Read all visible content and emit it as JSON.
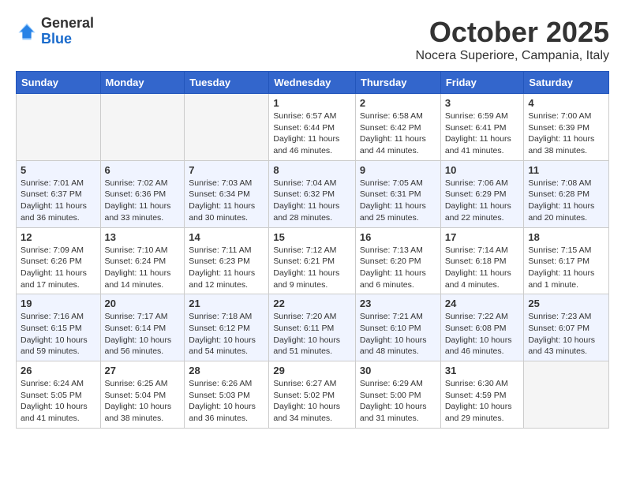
{
  "header": {
    "logo_general": "General",
    "logo_blue": "Blue",
    "month_title": "October 2025",
    "location": "Nocera Superiore, Campania, Italy"
  },
  "weekdays": [
    "Sunday",
    "Monday",
    "Tuesday",
    "Wednesday",
    "Thursday",
    "Friday",
    "Saturday"
  ],
  "weeks": [
    [
      {
        "day": "",
        "empty": true
      },
      {
        "day": "",
        "empty": true
      },
      {
        "day": "",
        "empty": true
      },
      {
        "day": "1",
        "sunrise": "6:57 AM",
        "sunset": "6:44 PM",
        "daylight": "11 hours and 46 minutes."
      },
      {
        "day": "2",
        "sunrise": "6:58 AM",
        "sunset": "6:42 PM",
        "daylight": "11 hours and 44 minutes."
      },
      {
        "day": "3",
        "sunrise": "6:59 AM",
        "sunset": "6:41 PM",
        "daylight": "11 hours and 41 minutes."
      },
      {
        "day": "4",
        "sunrise": "7:00 AM",
        "sunset": "6:39 PM",
        "daylight": "11 hours and 38 minutes."
      }
    ],
    [
      {
        "day": "5",
        "sunrise": "7:01 AM",
        "sunset": "6:37 PM",
        "daylight": "11 hours and 36 minutes."
      },
      {
        "day": "6",
        "sunrise": "7:02 AM",
        "sunset": "6:36 PM",
        "daylight": "11 hours and 33 minutes."
      },
      {
        "day": "7",
        "sunrise": "7:03 AM",
        "sunset": "6:34 PM",
        "daylight": "11 hours and 30 minutes."
      },
      {
        "day": "8",
        "sunrise": "7:04 AM",
        "sunset": "6:32 PM",
        "daylight": "11 hours and 28 minutes."
      },
      {
        "day": "9",
        "sunrise": "7:05 AM",
        "sunset": "6:31 PM",
        "daylight": "11 hours and 25 minutes."
      },
      {
        "day": "10",
        "sunrise": "7:06 AM",
        "sunset": "6:29 PM",
        "daylight": "11 hours and 22 minutes."
      },
      {
        "day": "11",
        "sunrise": "7:08 AM",
        "sunset": "6:28 PM",
        "daylight": "11 hours and 20 minutes."
      }
    ],
    [
      {
        "day": "12",
        "sunrise": "7:09 AM",
        "sunset": "6:26 PM",
        "daylight": "11 hours and 17 minutes."
      },
      {
        "day": "13",
        "sunrise": "7:10 AM",
        "sunset": "6:24 PM",
        "daylight": "11 hours and 14 minutes."
      },
      {
        "day": "14",
        "sunrise": "7:11 AM",
        "sunset": "6:23 PM",
        "daylight": "11 hours and 12 minutes."
      },
      {
        "day": "15",
        "sunrise": "7:12 AM",
        "sunset": "6:21 PM",
        "daylight": "11 hours and 9 minutes."
      },
      {
        "day": "16",
        "sunrise": "7:13 AM",
        "sunset": "6:20 PM",
        "daylight": "11 hours and 6 minutes."
      },
      {
        "day": "17",
        "sunrise": "7:14 AM",
        "sunset": "6:18 PM",
        "daylight": "11 hours and 4 minutes."
      },
      {
        "day": "18",
        "sunrise": "7:15 AM",
        "sunset": "6:17 PM",
        "daylight": "11 hours and 1 minute."
      }
    ],
    [
      {
        "day": "19",
        "sunrise": "7:16 AM",
        "sunset": "6:15 PM",
        "daylight": "10 hours and 59 minutes."
      },
      {
        "day": "20",
        "sunrise": "7:17 AM",
        "sunset": "6:14 PM",
        "daylight": "10 hours and 56 minutes."
      },
      {
        "day": "21",
        "sunrise": "7:18 AM",
        "sunset": "6:12 PM",
        "daylight": "10 hours and 54 minutes."
      },
      {
        "day": "22",
        "sunrise": "7:20 AM",
        "sunset": "6:11 PM",
        "daylight": "10 hours and 51 minutes."
      },
      {
        "day": "23",
        "sunrise": "7:21 AM",
        "sunset": "6:10 PM",
        "daylight": "10 hours and 48 minutes."
      },
      {
        "day": "24",
        "sunrise": "7:22 AM",
        "sunset": "6:08 PM",
        "daylight": "10 hours and 46 minutes."
      },
      {
        "day": "25",
        "sunrise": "7:23 AM",
        "sunset": "6:07 PM",
        "daylight": "10 hours and 43 minutes."
      }
    ],
    [
      {
        "day": "26",
        "sunrise": "6:24 AM",
        "sunset": "5:05 PM",
        "daylight": "10 hours and 41 minutes."
      },
      {
        "day": "27",
        "sunrise": "6:25 AM",
        "sunset": "5:04 PM",
        "daylight": "10 hours and 38 minutes."
      },
      {
        "day": "28",
        "sunrise": "6:26 AM",
        "sunset": "5:03 PM",
        "daylight": "10 hours and 36 minutes."
      },
      {
        "day": "29",
        "sunrise": "6:27 AM",
        "sunset": "5:02 PM",
        "daylight": "10 hours and 34 minutes."
      },
      {
        "day": "30",
        "sunrise": "6:29 AM",
        "sunset": "5:00 PM",
        "daylight": "10 hours and 31 minutes."
      },
      {
        "day": "31",
        "sunrise": "6:30 AM",
        "sunset": "4:59 PM",
        "daylight": "10 hours and 29 minutes."
      },
      {
        "day": "",
        "empty": true
      }
    ]
  ]
}
